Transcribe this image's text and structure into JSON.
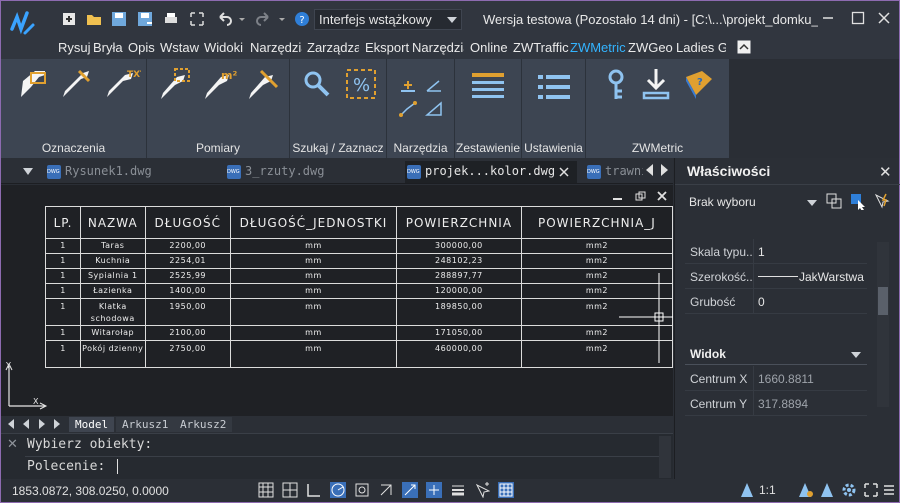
{
  "titlebar": {
    "workspace": "Interfejs wstążkowy",
    "title": "Wersja testowa (Pozostało 14 dni) - [C:\\...\\projekt_domku_obwie"
  },
  "menu": {
    "items": [
      "Rysuj",
      "Bryła",
      "Opis",
      "Wstaw",
      "Widoki",
      "Narzędzia",
      "Zarządzaj",
      "Eksport",
      "Narzędzia",
      "Online",
      "ZWTraffic",
      "ZWMetric",
      "ZWGeo",
      "Ladies Gr"
    ],
    "active": "ZWMetric"
  },
  "ribbon": {
    "groups": [
      "Oznaczenia",
      "Pomiary",
      "Szukaj / Zaznacz",
      "Narzędzia",
      "Zestawienie",
      "Ustawienia",
      "ZWMetric"
    ]
  },
  "doc_tabs": [
    {
      "label": "Rysunek1.dwg"
    },
    {
      "label": "3_rzuty.dwg"
    },
    {
      "label": "projek...kolor.dwg"
    },
    {
      "label": "trawni"
    }
  ],
  "table": {
    "headers": [
      "LP.",
      "NAZWA",
      "DŁUGOŚĆ",
      "DŁUGOŚĆ_JEDNOSTKI",
      "POWIERZCHNIA",
      "POWIERZCHNIA_J"
    ],
    "rows": [
      {
        "lp": "1",
        "name": "Taras",
        "length": "2200,00",
        "lunit": "mm",
        "area": "300000,00",
        "aunit": "mm2"
      },
      {
        "lp": "1",
        "name": "Kuchnia",
        "length": "2254,01",
        "lunit": "mm",
        "area": "248102,23",
        "aunit": "mm2"
      },
      {
        "lp": "1",
        "name": "Sypialnia 1",
        "length": "2525,99",
        "lunit": "mm",
        "area": "288897,77",
        "aunit": "mm2"
      },
      {
        "lp": "1",
        "name": "Łazienka",
        "length": "1400,00",
        "lunit": "mm",
        "area": "120000,00",
        "aunit": "mm2"
      },
      {
        "lp": "1",
        "name": "Klatka schodowa",
        "length": "1950,00",
        "lunit": "mm",
        "area": "189850,00",
        "aunit": "mm2"
      },
      {
        "lp": "1",
        "name": "Witarołap",
        "length": "2100,00",
        "lunit": "mm",
        "area": "171050,00",
        "aunit": "mm2"
      },
      {
        "lp": "1",
        "name": "Pokój dzienny",
        "length": "2750,00",
        "lunit": "mm",
        "area": "460000,00",
        "aunit": "mm2"
      }
    ]
  },
  "ucs": {
    "x": "X",
    "y": "Y"
  },
  "layout_tabs": [
    "Model",
    "Arkusz1",
    "Arkusz2"
  ],
  "command": {
    "history": "Wybierz obiekty:",
    "prompt": "Polecenie:"
  },
  "status": {
    "coords": "1853.0872, 308.0250, 0.0000",
    "scale": "1:1"
  },
  "properties": {
    "title": "Właściwości",
    "selection": "Brak wyboru",
    "rows": [
      {
        "label": "Skala typu...",
        "value": "1"
      },
      {
        "label": "Szerokość...",
        "value": "JakWarstwa"
      },
      {
        "label": "Grubość",
        "value": "0"
      }
    ],
    "section": "Widok",
    "view_rows": [
      {
        "label": "Centrum X",
        "value": "1660.8811"
      },
      {
        "label": "Centrum Y",
        "value": "317.8894"
      }
    ]
  },
  "colors": {
    "accent": "#33b4ff",
    "ribbon": "#3d4552",
    "canvas": "#1f2125"
  }
}
